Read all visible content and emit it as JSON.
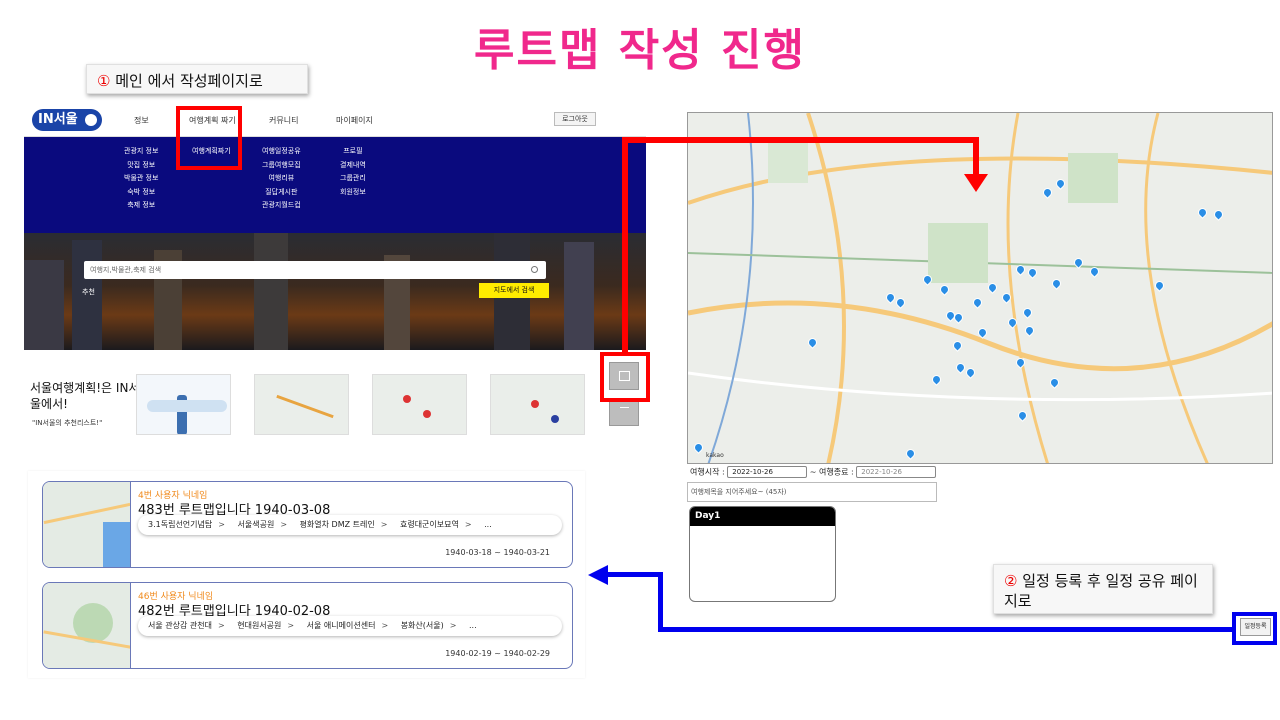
{
  "page_title": "루트맵 작성 진행",
  "callout1": {
    "num": "①",
    "text": " 메인 에서 작성페이지로"
  },
  "callout2": {
    "num": "②",
    "text": " 일정 등록 후 일정 공유 페이지로"
  },
  "site": {
    "logo": "IN서울",
    "nav": [
      "정보",
      "여행계획 짜기",
      "커뮤니티",
      "마이페이지"
    ],
    "logout": "로그아웃",
    "mega_cols": [
      [
        "관광지 정보",
        "맛집 정보",
        "박물관 정보",
        "숙박 정보",
        "축제 정보"
      ],
      [
        "여행계획짜기"
      ],
      [
        "여행일정공유",
        "그룹여행모집",
        "여행리뷰",
        "질답게시판",
        "관광지월드컵"
      ],
      [
        "프로필",
        "결제내역",
        "그룹관리",
        "회원정보"
      ]
    ],
    "search_placeholder": "여행지,박물관,축제 검색",
    "reco": "추천",
    "map_search": "지도에서 검색",
    "promo_title": "서울여행계획!은 IN서울에서!",
    "promo_sub": "\"IN서울의 추천리스트!\""
  },
  "planner": {
    "start_label": "여행시작 :",
    "start_date": "2022-10-26",
    "sep": "~",
    "end_label": "여행종료 :",
    "end_date": "2022-10-26",
    "title_placeholder": "여행제목을 지어주세요~ (45자)",
    "day_label": "Day1",
    "save_button": "일정등록",
    "map_credit": "kakao"
  },
  "routes": [
    {
      "nick": "4번 사용자 닉네임",
      "title": "483번 루트맵입니다 1940-03-08",
      "stops": [
        "3.1독립선언기념탑",
        "서울색공원",
        "평화열차 DMZ 트레인",
        "효령대군이보묘역",
        "..."
      ],
      "dates": "1940-03-18 ~ 1940-03-21"
    },
    {
      "nick": "46번 사용자 닉네임",
      "title": "482번 루트맵입니다 1940-02-08",
      "stops": [
        "서울 관상감 관천대",
        "현대원서공원",
        "서울 애니메이션센터",
        "봉화산(서울)",
        "..."
      ],
      "dates": "1940-02-19 ~ 1940-02-29"
    }
  ],
  "colors": {
    "title": "#f0288c",
    "nav_bg": "#0a0a7e",
    "highlight_red": "#ff0000",
    "arrow_blue": "#0000ee",
    "pin": "#2a8ee6",
    "nick": "#f08a1c"
  }
}
